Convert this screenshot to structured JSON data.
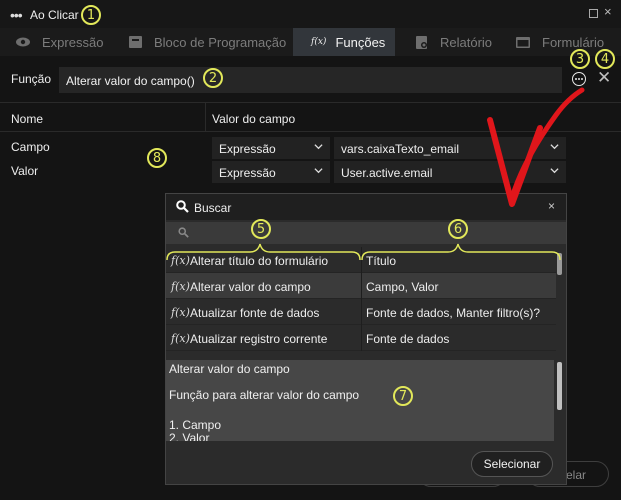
{
  "window": {
    "title": "Ao Clicar",
    "menu_icon": "ellipsis-icon",
    "maximize_icon": "maximize-icon",
    "close_icon": "close-icon"
  },
  "tabs": [
    {
      "label": "Expressão",
      "icon": "eye-icon",
      "active": false
    },
    {
      "label": "Bloco de Programação",
      "icon": "block-icon",
      "active": false
    },
    {
      "label": "Funções",
      "icon": "function-icon",
      "icon_text": "f(x)",
      "active": true
    },
    {
      "label": "Relatório",
      "icon": "report-icon",
      "active": false
    },
    {
      "label": "Formulário",
      "icon": "form-icon",
      "active": false
    }
  ],
  "function_row": {
    "label": "Função",
    "value": "Alterar valor do campo()"
  },
  "grid": {
    "headers": {
      "name": "Nome",
      "value": "Valor do campo"
    },
    "rows": [
      {
        "name": "Campo",
        "type": "Expressão",
        "value": "vars.caixaTexto_email"
      },
      {
        "name": "Valor",
        "type": "Expressão",
        "value": "User.active.email"
      }
    ]
  },
  "bottom_buttons": {
    "cancel_partial": "elar"
  },
  "popup": {
    "title": "Buscar",
    "close_label": "×",
    "search_placeholder": "",
    "functions": [
      {
        "fx": "f(x)",
        "name": "Alterar título do formulário",
        "params": "Título"
      },
      {
        "fx": "f(x)",
        "name": "Alterar valor do campo",
        "params": "Campo, Valor",
        "selected": true
      },
      {
        "fx": "f(x)",
        "name": "Atualizar fonte de dados",
        "params": "Fonte de dados, Manter filtro(s)?"
      },
      {
        "fx": "f(x)",
        "name": "Atualizar registro corrente",
        "params": "Fonte de dados"
      }
    ],
    "description": {
      "title": "Alterar valor do campo",
      "text": "Função para alterar valor do campo",
      "param1": "1. Campo",
      "param2": "2. Valor"
    },
    "select_button": "Selecionar"
  },
  "annotations": [
    "1",
    "2",
    "3",
    "4",
    "5",
    "6",
    "7",
    "8"
  ],
  "colors": {
    "annotation": "#e2e85a",
    "arrow": "#e0161b",
    "active_tab": "#32363b"
  }
}
